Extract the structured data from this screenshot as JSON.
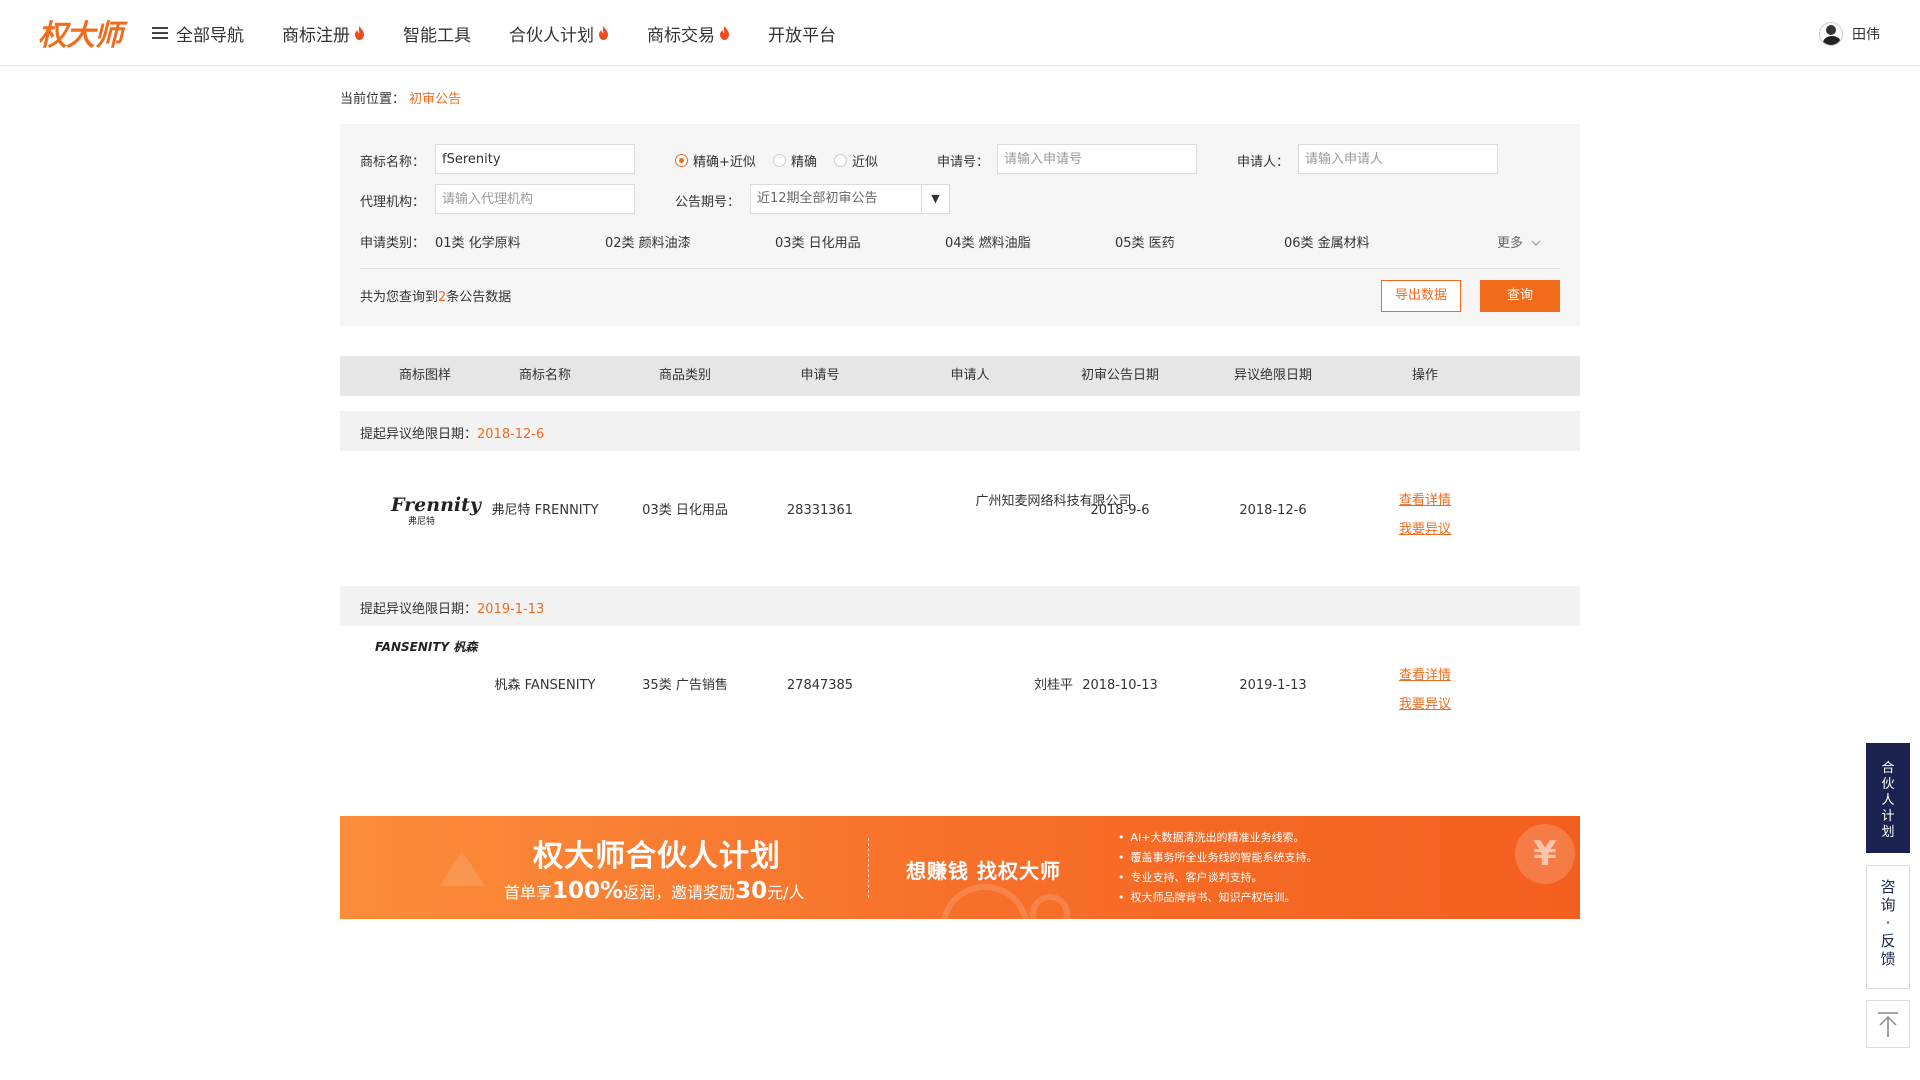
{
  "header": {
    "logo": "权大师",
    "nav": [
      {
        "label": "全部导航",
        "hot": false
      },
      {
        "label": "商标注册",
        "hot": true
      },
      {
        "label": "智能工具",
        "hot": false
      },
      {
        "label": "合伙人计划",
        "hot": true
      },
      {
        "label": "商标交易",
        "hot": true
      },
      {
        "label": "开放平台",
        "hot": false
      }
    ],
    "user_name": "田伟"
  },
  "breadcrumb": {
    "prefix": "当前位置：",
    "current": "初审公告"
  },
  "search": {
    "trademark_label": "商标名称：",
    "trademark_value": "fSerenity",
    "match_options": [
      {
        "label": "精确+近似",
        "selected": true
      },
      {
        "label": "精确",
        "selected": false
      },
      {
        "label": "近似",
        "selected": false
      }
    ],
    "app_no_label": "申请号：",
    "app_no_placeholder": "请输入申请号",
    "applicant_label": "申请人：",
    "applicant_placeholder": "请输入申请人",
    "agency_label": "代理机构：",
    "agency_placeholder": "请输入代理机构",
    "issue_label": "公告期号：",
    "issue_value": "近12期全部初审公告",
    "category_label": "申请类别：",
    "categories": [
      "01类 化学原料",
      "02类 颜料油漆",
      "03类 日化用品",
      "04类 燃料油脂",
      "05类 医药",
      "06类 金属材料"
    ],
    "more_label": "更多",
    "count_prefix": "共为您查询到",
    "count_value": "2",
    "count_suffix": "条公告数据",
    "export_label": "导出数据",
    "query_label": "查询"
  },
  "table": {
    "headers": [
      "商标图样",
      "商标名称",
      "商品类别",
      "申请号",
      "申请人",
      "初审公告日期",
      "异议绝限日期",
      "操作"
    ],
    "group_label": "提起异议绝限日期：",
    "rows": [
      {
        "group_date": "2018-12-6",
        "logo_text": "Frennity",
        "logo_sub": "弗尼特",
        "name": "弗尼特 FRENNITY",
        "category": "03类 日化用品",
        "app_no": "28331361",
        "applicant": "广州知麦网络科技有限公司",
        "pub_date": "2018-9-6",
        "deadline": "2018-12-6",
        "action_detail": "查看详情",
        "action_oppose": "我要异议"
      },
      {
        "group_date": "2019-1-13",
        "logo_text": "FANSENITY 杋森",
        "name": "杋森 FANSENITY",
        "category": "35类 广告销售",
        "app_no": "27847385",
        "applicant": "刘桂平",
        "pub_date": "2018-10-13",
        "deadline": "2019-1-13",
        "action_detail": "查看详情",
        "action_oppose": "我要异议"
      }
    ]
  },
  "banner": {
    "title": "权大师合伙人计划",
    "sub_prefix": "首单享",
    "sub_pct": "100%",
    "sub_mid": "返润，邀请奖励",
    "sub_amount": "30",
    "sub_suffix": "元/人",
    "slogan": "想赚钱 找权大师",
    "points": [
      "AI+大数据清洗出的精准业务线索。",
      "覆盖事务所全业务线的智能系统支持。",
      "专业支持、客户谈判支持。",
      "权大师品牌背书、知识产权培训。"
    ],
    "yen": "¥"
  },
  "float": {
    "partner": [
      "合",
      "伙",
      "人",
      "计",
      "划"
    ],
    "consult": [
      "咨",
      "询",
      "·",
      "反",
      "馈"
    ]
  },
  "colors": {
    "accent": "#f26b1d",
    "navy": "#1b2451"
  }
}
